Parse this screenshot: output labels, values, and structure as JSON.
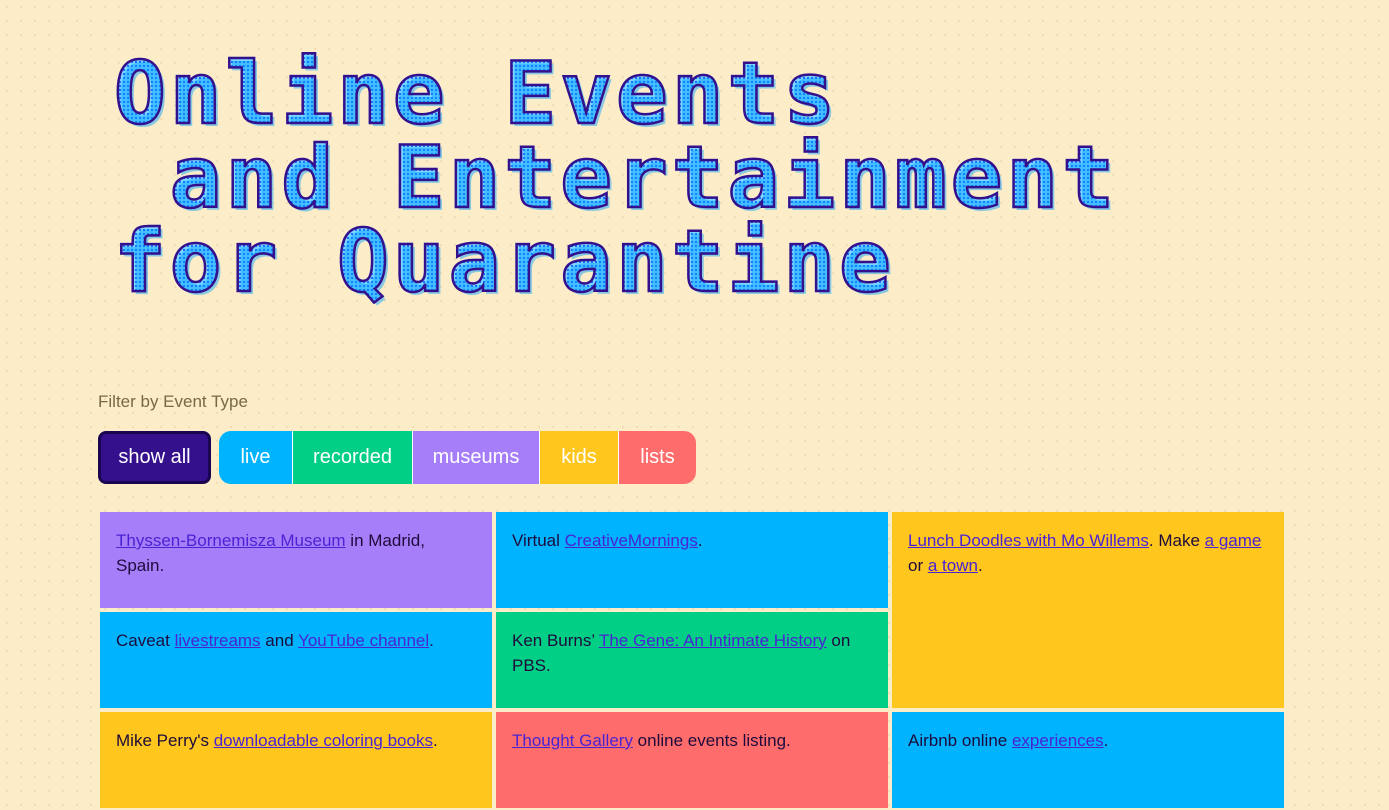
{
  "title": {
    "line1": "Online Events",
    "line2": " and Entertainment",
    "line3": "for Quarantine"
  },
  "filters": {
    "label": "Filter by Event Type",
    "buttons": [
      "show all",
      "live",
      "recorded",
      "museums",
      "kids",
      "lists"
    ]
  },
  "colors": {
    "background": "#fdecc8",
    "museums": "#a77ef9",
    "live": "#00b3ff",
    "recorded": "#00cf85",
    "kids": "#ffc61e",
    "lists": "#ff6c6c",
    "active_filter": "#35108c",
    "link": "#4a23d4"
  },
  "cards": [
    {
      "type": "museums",
      "parts": [
        {
          "link": "Thyssen-Bornemisza Museum"
        },
        {
          "text": " in Madrid, Spain."
        }
      ]
    },
    {
      "type": "live",
      "parts": [
        {
          "text": "Virtual "
        },
        {
          "link": "CreativeMornings"
        },
        {
          "text": "."
        }
      ]
    },
    {
      "type": "kids",
      "parts": [
        {
          "link": "Lunch Doodles with Mo Willems"
        },
        {
          "text": ". Make "
        },
        {
          "link": "a game"
        },
        {
          "text": " or "
        },
        {
          "link": "a town"
        },
        {
          "text": "."
        }
      ]
    },
    {
      "type": "live",
      "parts": [
        {
          "text": "Caveat "
        },
        {
          "link": "livestreams"
        },
        {
          "text": " and "
        },
        {
          "link": "YouTube channel"
        },
        {
          "text": "."
        }
      ]
    },
    {
      "type": "recorded",
      "parts": [
        {
          "text": "Ken Burns’ "
        },
        {
          "link": "The Gene: An Intimate History"
        },
        {
          "text": " on PBS."
        }
      ]
    },
    {
      "type": "kids",
      "parts": [
        {
          "text": "Mike Perry's "
        },
        {
          "link": "downloadable coloring books"
        },
        {
          "text": "."
        }
      ]
    },
    {
      "type": "lists",
      "parts": [
        {
          "link": "Thought Gallery"
        },
        {
          "text": " online events listing."
        }
      ]
    },
    {
      "type": "live",
      "parts": [
        {
          "text": "Airbnb online "
        },
        {
          "link": "experiences"
        },
        {
          "text": "."
        }
      ]
    }
  ]
}
